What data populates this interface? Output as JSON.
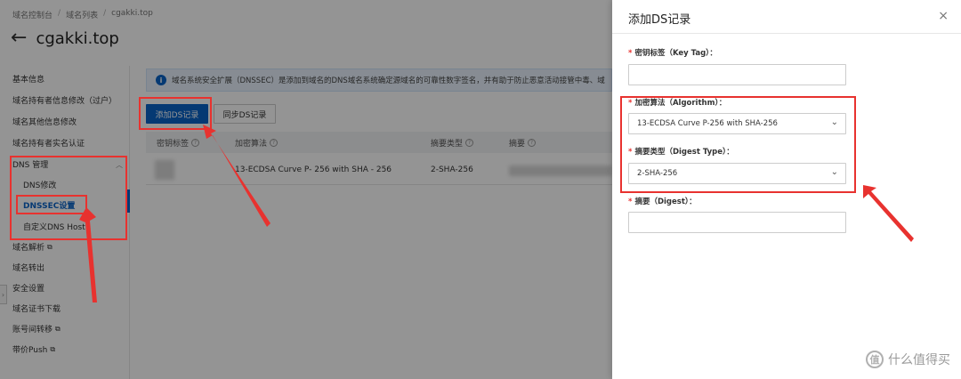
{
  "breadcrumb": [
    "域名控制台",
    "域名列表",
    "cgakki.top"
  ],
  "breadcrumb_sep": "/",
  "page": {
    "back_icon": "arrow-left-icon",
    "title": "cgakki.top"
  },
  "sidebar": {
    "items": [
      {
        "label": "基本信息"
      },
      {
        "label": "域名持有者信息修改（过户）"
      },
      {
        "label": "域名其他信息修改"
      },
      {
        "label": "域名持有者实名认证"
      },
      {
        "label": "DNS 管理"
      },
      {
        "label": "DNS修改"
      },
      {
        "label": "DNSSEC设置"
      },
      {
        "label": "自定义DNS Host"
      },
      {
        "label": "域名解析"
      },
      {
        "label": "域名转出"
      },
      {
        "label": "安全设置"
      },
      {
        "label": "域名证书下载"
      },
      {
        "label": "账号间转移"
      },
      {
        "label": "带价Push"
      }
    ],
    "collapse_glyph": "›"
  },
  "info_bar": {
    "icon": "i",
    "text": "域名系统安全扩展（DNSSEC）是添加到域名的DNS域名系统确定源域名的可靠性数字签名，并有助于防止恶意活动接管中毒、域"
  },
  "buttons": {
    "add_ds": "添加DS记录",
    "sync_ds": "同步DS记录"
  },
  "table": {
    "headers": [
      "密钥标签",
      "加密算法",
      "摘要类型",
      "摘要"
    ],
    "row": {
      "algorithm": "13-ECDSA Curve P- 256 with SHA - 256",
      "digest_type": "2-SHA-256"
    }
  },
  "drawer": {
    "title": "添加DS记录",
    "close_glyph": "×",
    "required_mark": "*",
    "fields": {
      "key_tag": {
        "label": "密钥标签（Key Tag）：",
        "value": ""
      },
      "algorithm": {
        "label": "加密算法（Algorithm）：",
        "value": "13-ECDSA Curve P-256 with SHA-256"
      },
      "digest_type": {
        "label": "摘要类型（Digest Type）：",
        "value": "2-SHA-256"
      },
      "digest": {
        "label": "摘要（Digest）：",
        "value": ""
      }
    }
  },
  "watermark": {
    "glyph": "值",
    "text": "什么值得买"
  },
  "colors": {
    "primary": "#0a63c7",
    "annotation_red": "#e8322f",
    "overlay": "rgba(0,0,0,0.42)"
  }
}
